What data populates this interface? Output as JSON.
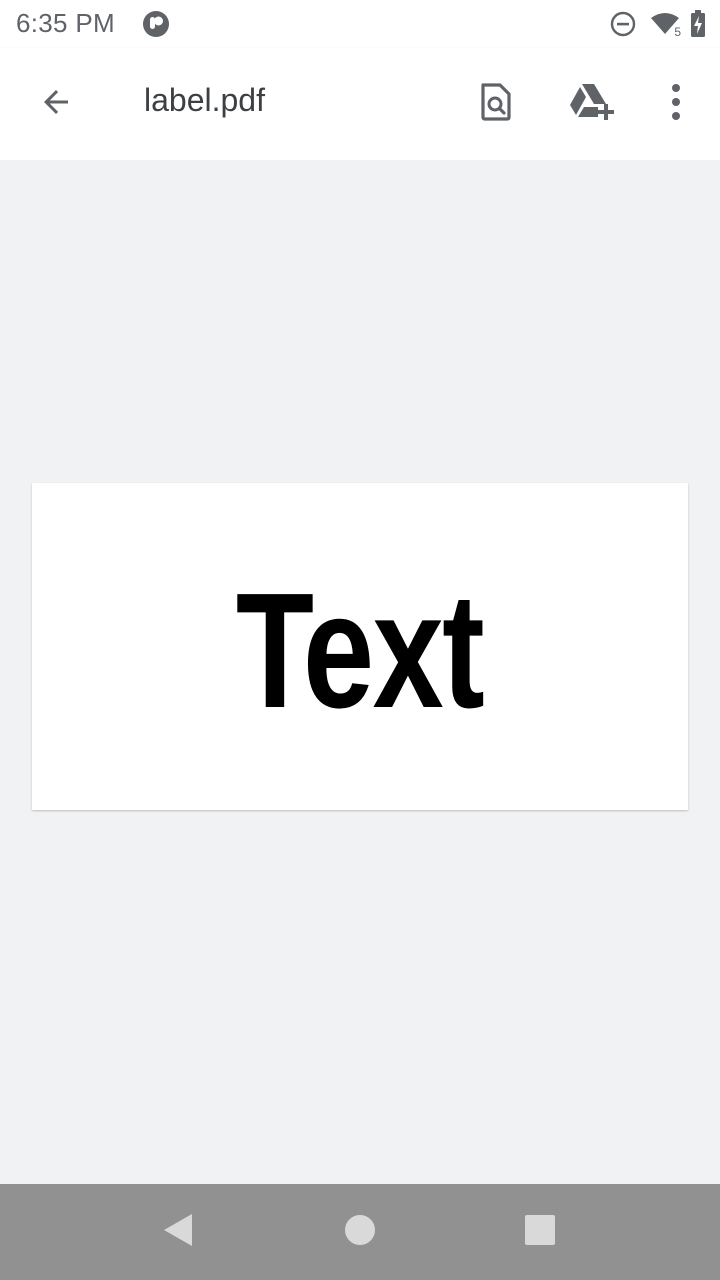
{
  "status_bar": {
    "time": "6:35 PM",
    "icons": [
      "app-notification-icon",
      "do-not-disturb-icon",
      "wifi-icon",
      "battery-charging-icon"
    ],
    "wifi_badge": "5"
  },
  "app_bar": {
    "back_icon": "arrow-back-icon",
    "title": "label.pdf",
    "actions": [
      {
        "name": "find-in-document",
        "icon": "document-search-icon"
      },
      {
        "name": "add-to-drive",
        "icon": "drive-add-icon"
      },
      {
        "name": "more-options",
        "icon": "more-vert-icon"
      }
    ]
  },
  "document": {
    "page_text": "Text"
  },
  "nav_bar": {
    "buttons": [
      "back-triangle-icon",
      "home-circle-icon",
      "recents-square-icon"
    ]
  },
  "colors": {
    "toolbar_bg": "#ffffff",
    "viewer_bg": "#f1f2f4",
    "icon_gray": "#5f6368",
    "nav_bar_bg": "#919191"
  }
}
